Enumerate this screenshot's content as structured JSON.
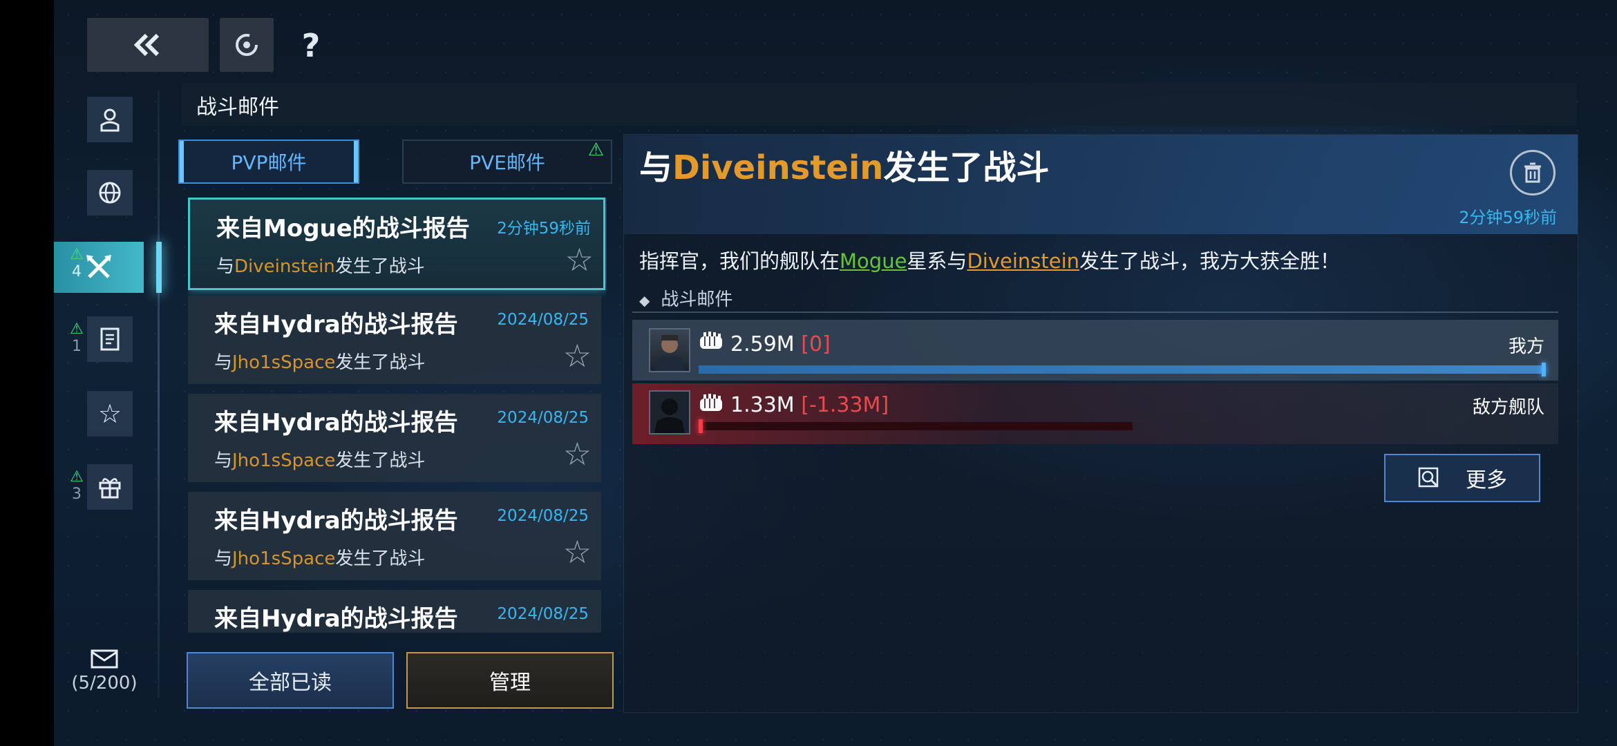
{
  "topbar": {
    "back_icon": "double-chevron-left-icon",
    "refresh_icon": "refresh-icon",
    "help_label": "?"
  },
  "sidebar": {
    "items": [
      {
        "icon": "profile-icon",
        "badge": "",
        "count": ""
      },
      {
        "icon": "globe-icon",
        "badge": "",
        "count": ""
      },
      {
        "icon": "battle-icon",
        "badge": "!",
        "count": "4",
        "active": true
      },
      {
        "icon": "document-icon",
        "badge": "!",
        "count": "1"
      },
      {
        "icon": "star-icon",
        "badge": "",
        "count": ""
      },
      {
        "icon": "gift-icon",
        "badge": "!",
        "count": "3"
      }
    ],
    "mail_counter": "(5/200)"
  },
  "panel": {
    "title": "战斗邮件"
  },
  "tabs": {
    "pvp": "PVP邮件",
    "pve": "PVE邮件"
  },
  "mails": [
    {
      "title": "来自Mogue的战斗报告",
      "time": "2分钟59秒前",
      "sub_prefix": "与",
      "sub_name": "Diveinstein",
      "sub_suffix": "发生了战斗",
      "selected": true
    },
    {
      "title": "来自Hydra的战斗报告",
      "time": "2024/08/25",
      "sub_prefix": "与",
      "sub_name": "Jho1sSpace",
      "sub_suffix": "发生了战斗"
    },
    {
      "title": "来自Hydra的战斗报告",
      "time": "2024/08/25",
      "sub_prefix": "与",
      "sub_name": "Jho1sSpace",
      "sub_suffix": "发生了战斗"
    },
    {
      "title": "来自Hydra的战斗报告",
      "time": "2024/08/25",
      "sub_prefix": "与",
      "sub_name": "Jho1sSpace",
      "sub_suffix": "发生了战斗"
    },
    {
      "title": "来自Hydra的战斗报告",
      "time": "2024/08/25",
      "sub_prefix": "",
      "sub_name": "",
      "sub_suffix": ""
    }
  ],
  "buttons": {
    "read_all": "全部已读",
    "manage": "管理",
    "more": "更多"
  },
  "detail": {
    "title_prefix": "与",
    "title_name": "Diveinstein",
    "title_suffix": "发生了战斗",
    "time": "2分钟59秒前",
    "msg_1": "指挥官，我们的舰队在",
    "msg_system": "Mogue",
    "msg_2": "星系与",
    "msg_enemy": "Diveinstein",
    "msg_3": "发生了战斗，我方大获全胜！",
    "section": "战斗邮件",
    "mine": {
      "power": "2.59M",
      "loss": "[0]",
      "label": "我方",
      "bar_fraction": 1.0
    },
    "enemy": {
      "power": "1.33M",
      "loss": "[-1.33M]",
      "label": "敌方舰队",
      "bar_fraction": 0.0
    }
  },
  "colors": {
    "accent_blue": "#39b6f0",
    "highlight_orange": "#e49a2a",
    "system_green": "#64c43c",
    "loss_red": "#f04848",
    "active_tab_teal": "#43b8c8"
  }
}
